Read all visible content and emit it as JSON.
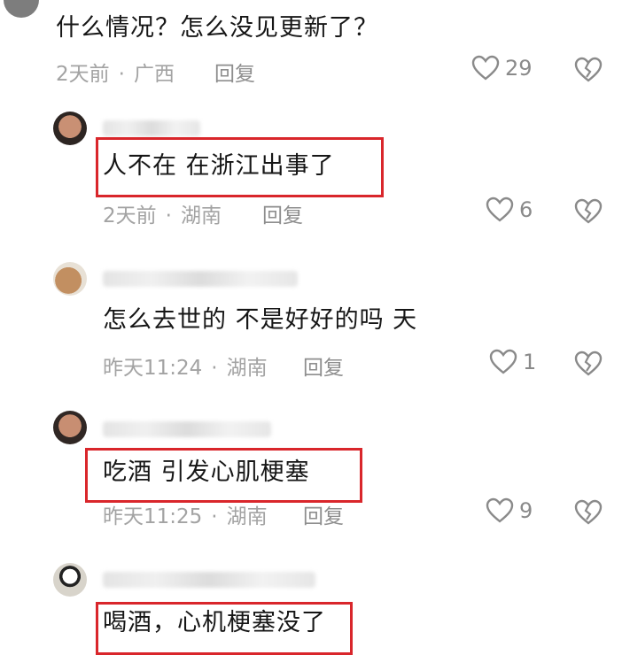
{
  "comments": [
    {
      "text": "什么情况？怎么没见更新了？",
      "time": "2天前",
      "location": "广西",
      "reply": "回复",
      "likes": "29"
    },
    {
      "text": "人不在 在浙江出事了",
      "time": "2天前",
      "location": "湖南",
      "reply": "回复",
      "likes": "6"
    },
    {
      "text": "怎么去世的 不是好好的吗 天",
      "time": "昨天11:24",
      "location": "湖南",
      "reply": "回复",
      "likes": "1"
    },
    {
      "text": "吃酒 引发心肌梗塞",
      "time": "昨天11:25",
      "location": "湖南",
      "reply": "回复",
      "likes": "9"
    },
    {
      "text": "喝酒，心机梗塞没了"
    }
  ],
  "separator": "·",
  "colors": {
    "highlight_box": "#d9262b",
    "meta_text": "#a3a3a3",
    "icon": "#8a8a8a"
  }
}
